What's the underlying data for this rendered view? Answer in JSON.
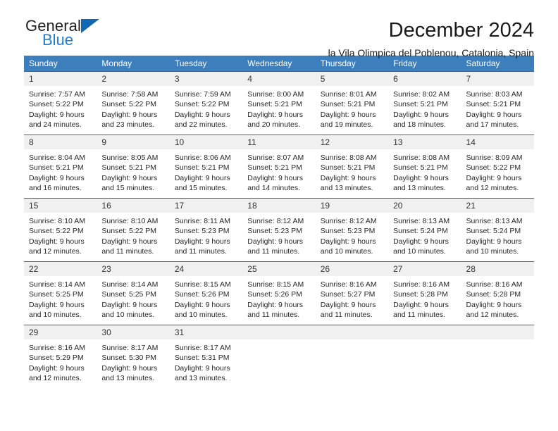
{
  "brand": {
    "name_part1": "General",
    "name_part2": "Blue",
    "logo_icon": "triangle-logo-icon",
    "colors": {
      "dark": "#231f20",
      "blue": "#1b7fd4",
      "triangle": "#1268b3"
    }
  },
  "header": {
    "month_title": "December 2024",
    "location": "la Vila Olimpica del Poblenou, Catalonia, Spain"
  },
  "calendar": {
    "accent_header_bg": "#3d7ebd",
    "row_border_color": "#2a6aab",
    "daynum_bg": "#f0f0f0",
    "weekday_headers": [
      "Sunday",
      "Monday",
      "Tuesday",
      "Wednesday",
      "Thursday",
      "Friday",
      "Saturday"
    ],
    "weeks": [
      [
        {
          "day": "1",
          "sunrise": "Sunrise: 7:57 AM",
          "sunset": "Sunset: 5:22 PM",
          "daylight_line1": "Daylight: 9 hours",
          "daylight_line2": "and 24 minutes."
        },
        {
          "day": "2",
          "sunrise": "Sunrise: 7:58 AM",
          "sunset": "Sunset: 5:22 PM",
          "daylight_line1": "Daylight: 9 hours",
          "daylight_line2": "and 23 minutes."
        },
        {
          "day": "3",
          "sunrise": "Sunrise: 7:59 AM",
          "sunset": "Sunset: 5:22 PM",
          "daylight_line1": "Daylight: 9 hours",
          "daylight_line2": "and 22 minutes."
        },
        {
          "day": "4",
          "sunrise": "Sunrise: 8:00 AM",
          "sunset": "Sunset: 5:21 PM",
          "daylight_line1": "Daylight: 9 hours",
          "daylight_line2": "and 20 minutes."
        },
        {
          "day": "5",
          "sunrise": "Sunrise: 8:01 AM",
          "sunset": "Sunset: 5:21 PM",
          "daylight_line1": "Daylight: 9 hours",
          "daylight_line2": "and 19 minutes."
        },
        {
          "day": "6",
          "sunrise": "Sunrise: 8:02 AM",
          "sunset": "Sunset: 5:21 PM",
          "daylight_line1": "Daylight: 9 hours",
          "daylight_line2": "and 18 minutes."
        },
        {
          "day": "7",
          "sunrise": "Sunrise: 8:03 AM",
          "sunset": "Sunset: 5:21 PM",
          "daylight_line1": "Daylight: 9 hours",
          "daylight_line2": "and 17 minutes."
        }
      ],
      [
        {
          "day": "8",
          "sunrise": "Sunrise: 8:04 AM",
          "sunset": "Sunset: 5:21 PM",
          "daylight_line1": "Daylight: 9 hours",
          "daylight_line2": "and 16 minutes."
        },
        {
          "day": "9",
          "sunrise": "Sunrise: 8:05 AM",
          "sunset": "Sunset: 5:21 PM",
          "daylight_line1": "Daylight: 9 hours",
          "daylight_line2": "and 15 minutes."
        },
        {
          "day": "10",
          "sunrise": "Sunrise: 8:06 AM",
          "sunset": "Sunset: 5:21 PM",
          "daylight_line1": "Daylight: 9 hours",
          "daylight_line2": "and 15 minutes."
        },
        {
          "day": "11",
          "sunrise": "Sunrise: 8:07 AM",
          "sunset": "Sunset: 5:21 PM",
          "daylight_line1": "Daylight: 9 hours",
          "daylight_line2": "and 14 minutes."
        },
        {
          "day": "12",
          "sunrise": "Sunrise: 8:08 AM",
          "sunset": "Sunset: 5:21 PM",
          "daylight_line1": "Daylight: 9 hours",
          "daylight_line2": "and 13 minutes."
        },
        {
          "day": "13",
          "sunrise": "Sunrise: 8:08 AM",
          "sunset": "Sunset: 5:21 PM",
          "daylight_line1": "Daylight: 9 hours",
          "daylight_line2": "and 13 minutes."
        },
        {
          "day": "14",
          "sunrise": "Sunrise: 8:09 AM",
          "sunset": "Sunset: 5:22 PM",
          "daylight_line1": "Daylight: 9 hours",
          "daylight_line2": "and 12 minutes."
        }
      ],
      [
        {
          "day": "15",
          "sunrise": "Sunrise: 8:10 AM",
          "sunset": "Sunset: 5:22 PM",
          "daylight_line1": "Daylight: 9 hours",
          "daylight_line2": "and 12 minutes."
        },
        {
          "day": "16",
          "sunrise": "Sunrise: 8:10 AM",
          "sunset": "Sunset: 5:22 PM",
          "daylight_line1": "Daylight: 9 hours",
          "daylight_line2": "and 11 minutes."
        },
        {
          "day": "17",
          "sunrise": "Sunrise: 8:11 AM",
          "sunset": "Sunset: 5:23 PM",
          "daylight_line1": "Daylight: 9 hours",
          "daylight_line2": "and 11 minutes."
        },
        {
          "day": "18",
          "sunrise": "Sunrise: 8:12 AM",
          "sunset": "Sunset: 5:23 PM",
          "daylight_line1": "Daylight: 9 hours",
          "daylight_line2": "and 11 minutes."
        },
        {
          "day": "19",
          "sunrise": "Sunrise: 8:12 AM",
          "sunset": "Sunset: 5:23 PM",
          "daylight_line1": "Daylight: 9 hours",
          "daylight_line2": "and 10 minutes."
        },
        {
          "day": "20",
          "sunrise": "Sunrise: 8:13 AM",
          "sunset": "Sunset: 5:24 PM",
          "daylight_line1": "Daylight: 9 hours",
          "daylight_line2": "and 10 minutes."
        },
        {
          "day": "21",
          "sunrise": "Sunrise: 8:13 AM",
          "sunset": "Sunset: 5:24 PM",
          "daylight_line1": "Daylight: 9 hours",
          "daylight_line2": "and 10 minutes."
        }
      ],
      [
        {
          "day": "22",
          "sunrise": "Sunrise: 8:14 AM",
          "sunset": "Sunset: 5:25 PM",
          "daylight_line1": "Daylight: 9 hours",
          "daylight_line2": "and 10 minutes."
        },
        {
          "day": "23",
          "sunrise": "Sunrise: 8:14 AM",
          "sunset": "Sunset: 5:25 PM",
          "daylight_line1": "Daylight: 9 hours",
          "daylight_line2": "and 10 minutes."
        },
        {
          "day": "24",
          "sunrise": "Sunrise: 8:15 AM",
          "sunset": "Sunset: 5:26 PM",
          "daylight_line1": "Daylight: 9 hours",
          "daylight_line2": "and 10 minutes."
        },
        {
          "day": "25",
          "sunrise": "Sunrise: 8:15 AM",
          "sunset": "Sunset: 5:26 PM",
          "daylight_line1": "Daylight: 9 hours",
          "daylight_line2": "and 11 minutes."
        },
        {
          "day": "26",
          "sunrise": "Sunrise: 8:16 AM",
          "sunset": "Sunset: 5:27 PM",
          "daylight_line1": "Daylight: 9 hours",
          "daylight_line2": "and 11 minutes."
        },
        {
          "day": "27",
          "sunrise": "Sunrise: 8:16 AM",
          "sunset": "Sunset: 5:28 PM",
          "daylight_line1": "Daylight: 9 hours",
          "daylight_line2": "and 11 minutes."
        },
        {
          "day": "28",
          "sunrise": "Sunrise: 8:16 AM",
          "sunset": "Sunset: 5:28 PM",
          "daylight_line1": "Daylight: 9 hours",
          "daylight_line2": "and 12 minutes."
        }
      ],
      [
        {
          "day": "29",
          "sunrise": "Sunrise: 8:16 AM",
          "sunset": "Sunset: 5:29 PM",
          "daylight_line1": "Daylight: 9 hours",
          "daylight_line2": "and 12 minutes."
        },
        {
          "day": "30",
          "sunrise": "Sunrise: 8:17 AM",
          "sunset": "Sunset: 5:30 PM",
          "daylight_line1": "Daylight: 9 hours",
          "daylight_line2": "and 13 minutes."
        },
        {
          "day": "31",
          "sunrise": "Sunrise: 8:17 AM",
          "sunset": "Sunset: 5:31 PM",
          "daylight_line1": "Daylight: 9 hours",
          "daylight_line2": "and 13 minutes."
        },
        {
          "day": "",
          "sunrise": "",
          "sunset": "",
          "daylight_line1": "",
          "daylight_line2": ""
        },
        {
          "day": "",
          "sunrise": "",
          "sunset": "",
          "daylight_line1": "",
          "daylight_line2": ""
        },
        {
          "day": "",
          "sunrise": "",
          "sunset": "",
          "daylight_line1": "",
          "daylight_line2": ""
        },
        {
          "day": "",
          "sunrise": "",
          "sunset": "",
          "daylight_line1": "",
          "daylight_line2": ""
        }
      ]
    ]
  }
}
